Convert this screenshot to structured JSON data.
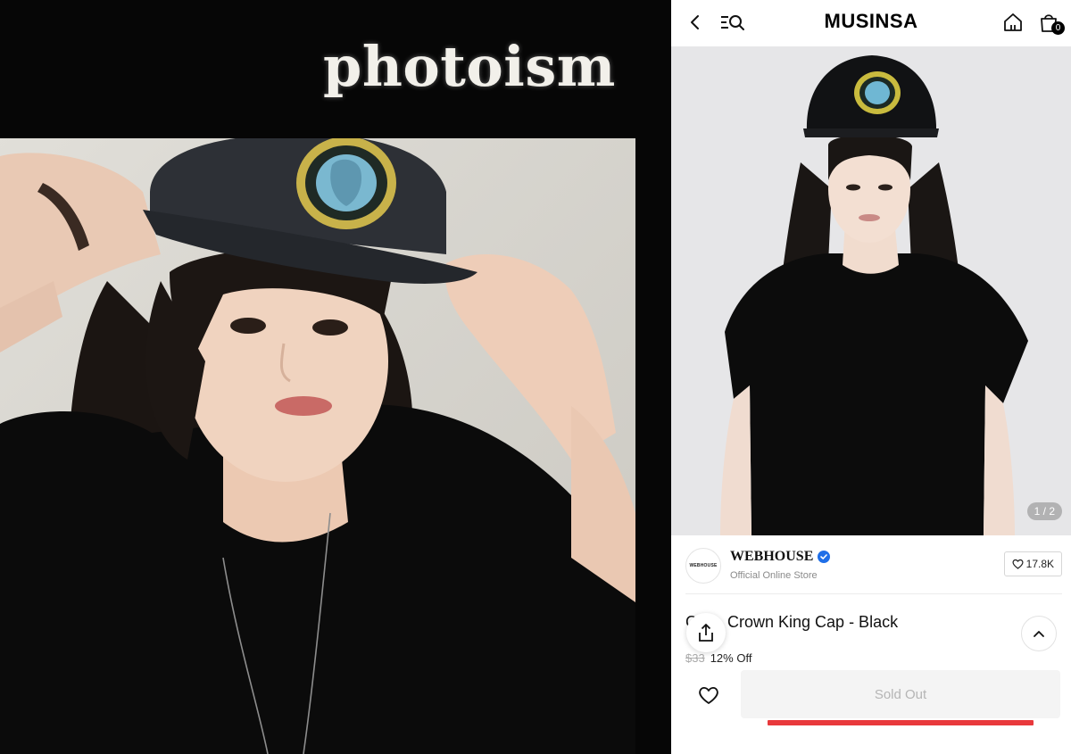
{
  "booth": {
    "logo_text": "photoism"
  },
  "app": {
    "header": {
      "brand": "MUSINSA",
      "back_icon": "chevron-left-icon",
      "menu_search_icon": "menu-search-icon",
      "home_icon": "home-icon",
      "cart_icon": "shopping-bag-icon",
      "cart_count": "0"
    },
    "gallery": {
      "pager": "1 / 2",
      "current": 1,
      "total": 2
    },
    "seller": {
      "logo_text": "WEBHOUSE",
      "name": "WEBHOUSE",
      "subtitle": "Official Online Store",
      "verified_color": "#1f6fe8",
      "likes": "17.8K"
    },
    "product": {
      "title": "Crown King Cap - Black",
      "title_prefix": "C",
      "original_price": "$33",
      "discount": "12% Off"
    },
    "actions": {
      "sold_out_label": "Sold Out",
      "share_icon": "share-icon",
      "collapse_icon": "chevron-up-icon",
      "wishlist_icon": "heart-icon"
    },
    "colors": {
      "accent_red": "#e8393c",
      "sold_out_bg": "#f4f4f4"
    }
  }
}
